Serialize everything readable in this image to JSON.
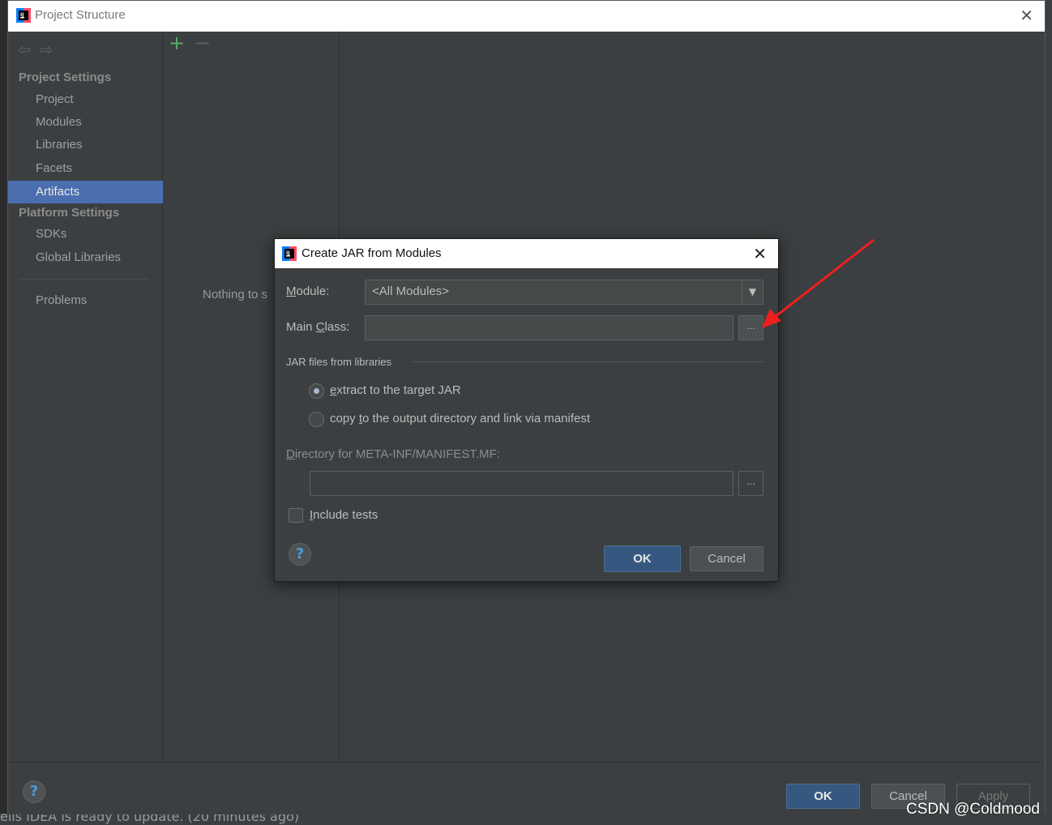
{
  "window": {
    "title": "Project Structure"
  },
  "sidebar": {
    "project_settings_header": "Project Settings",
    "platform_settings_header": "Platform Settings",
    "items": [
      {
        "label": "Project"
      },
      {
        "label": "Modules"
      },
      {
        "label": "Libraries"
      },
      {
        "label": "Facets"
      },
      {
        "label": "Artifacts",
        "selected": true
      },
      {
        "label": "SDKs"
      },
      {
        "label": "Global Libraries"
      },
      {
        "label": "Problems"
      }
    ]
  },
  "main": {
    "empty_text": "Nothing to s"
  },
  "footer": {
    "ok_label": "OK",
    "cancel_label": "Cancel",
    "apply_label": "Apply"
  },
  "dialog": {
    "title": "Create JAR from Modules",
    "module_label_mnemonic": "M",
    "module_label_rest": "odule:",
    "module_value": "<All Modules>",
    "main_class_label_before": "Main ",
    "main_class_label_mnemonic": "C",
    "main_class_label_after": "lass:",
    "main_class_value": "",
    "browse_label": "...",
    "jar_group_label": "JAR files from libraries",
    "radio_extract_mnemonic": "e",
    "radio_extract_rest": "xtract to the target JAR",
    "radio_copy_before": "copy ",
    "radio_copy_mnemonic": "t",
    "radio_copy_after": "o the output directory and link via manifest",
    "manifest_dir_mnemonic": "D",
    "manifest_dir_rest": "irectory for META-INF/MANIFEST.MF:",
    "manifest_dir_value": "",
    "include_tests_mnemonic": "I",
    "include_tests_rest": "nclude tests",
    "ok_label": "OK",
    "cancel_label": "Cancel",
    "help_label": "?"
  },
  "background": {
    "status_text": "ells IDEA is ready to update. (20 minutes ago)"
  },
  "watermark": "CSDN @Coldmood",
  "colors": {
    "accent_selected": "#4b6eaf",
    "primary_button": "#365880",
    "add_icon": "#59a869",
    "annotation_arrow": "#f01e1e"
  }
}
